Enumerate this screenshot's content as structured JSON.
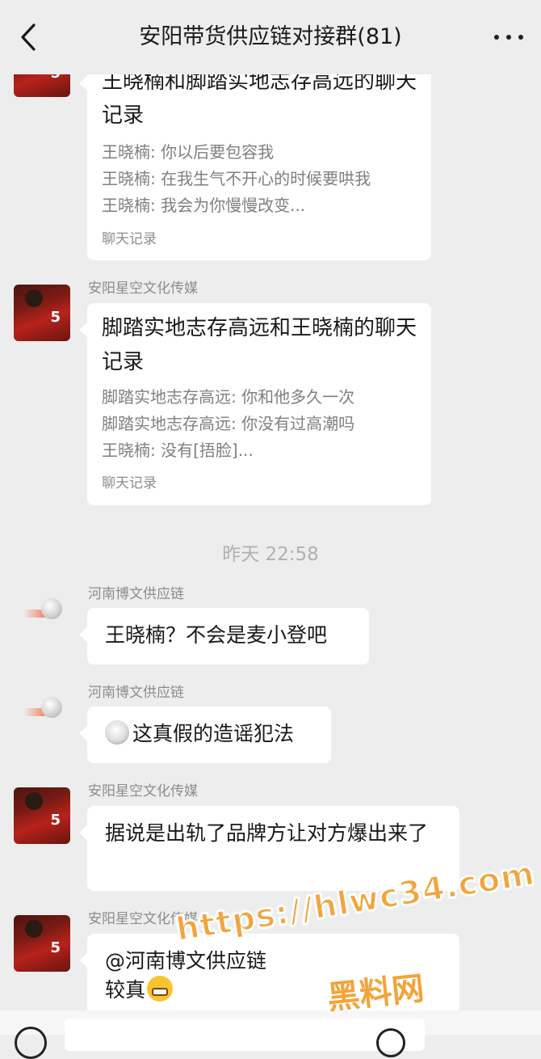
{
  "header": {
    "title": "安阳带货供应链对接群(81)",
    "back_icon": "chevron-left-icon",
    "more_icon": "more-dots-icon"
  },
  "messages": [
    {
      "sender": "",
      "avatar": "red-jersey-5",
      "type": "chat_record",
      "title": "王晓楠和脚踏实地志存高远的聊天记录",
      "lines": [
        "王晓楠: 你以后要包容我",
        "王晓楠: 在我生气不开心的时候要哄我",
        "王晓楠: 我会为你慢慢改变..."
      ],
      "footer": "聊天记录"
    },
    {
      "sender": "安阳星空文化传媒",
      "avatar": "red-jersey-5",
      "type": "chat_record",
      "title": "脚踏实地志存高远和王晓楠的聊天记录",
      "lines": [
        "脚踏实地志存高远: 你和他多久一次",
        "脚踏实地志存高远: 你没有过高潮吗",
        "王晓楠: 没有[捂脸]..."
      ],
      "footer": "聊天记录"
    },
    {
      "sender": "河南博文供应链",
      "avatar": "white-ball",
      "type": "text",
      "text": "王晓楠？不会是麦小登吧"
    },
    {
      "sender": "河南博文供应链",
      "avatar": "white-ball",
      "type": "text",
      "emoji": "fist-emoji",
      "text": "这真假的造谣犯法"
    },
    {
      "sender": "安阳星空文化传媒",
      "avatar": "red-jersey-5",
      "type": "text",
      "text": "据说是出轨了品牌方让对方爆出来了"
    },
    {
      "sender": "安阳星空文化传媒",
      "avatar": "red-jersey-5",
      "type": "text",
      "text_line1": "@河南博文供应链",
      "text_line2": "较真",
      "emoji": "grin-emoji"
    }
  ],
  "timestamp": "昨天 22:58",
  "watermark": {
    "url": "https://hlwc34.com",
    "name": "黑料网"
  },
  "input_bar": {
    "voice_icon": "voice-icon",
    "emoji_icon": "emoji-icon"
  }
}
